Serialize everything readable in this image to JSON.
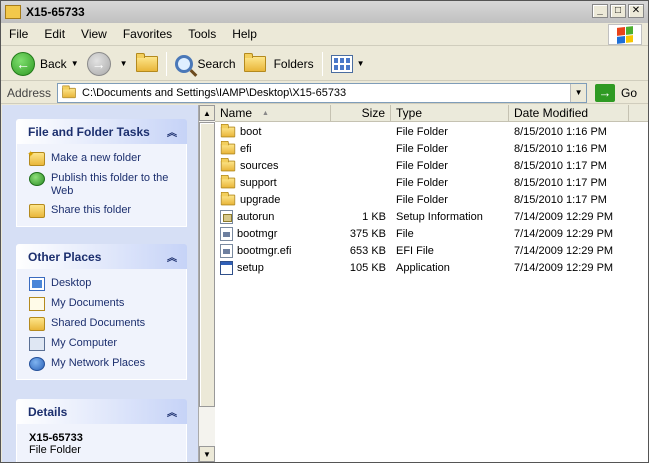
{
  "window": {
    "title": "X15-65733"
  },
  "menu": [
    "File",
    "Edit",
    "View",
    "Favorites",
    "Tools",
    "Help"
  ],
  "toolbar": {
    "back_label": "Back",
    "search_label": "Search",
    "folders_label": "Folders"
  },
  "address": {
    "label": "Address",
    "path": "C:\\Documents and Settings\\IAMP\\Desktop\\X15-65733",
    "go_label": "Go"
  },
  "tasks": {
    "title": "File and Folder Tasks",
    "items": [
      "Make a new folder",
      "Publish this folder to the Web",
      "Share this folder"
    ]
  },
  "places": {
    "title": "Other Places",
    "items": [
      "Desktop",
      "My Documents",
      "Shared Documents",
      "My Computer",
      "My Network Places"
    ]
  },
  "details": {
    "title": "Details",
    "name": "X15-65733",
    "type": "File Folder"
  },
  "columns": {
    "name": "Name",
    "size": "Size",
    "type": "Type",
    "date": "Date Modified"
  },
  "files": [
    {
      "name": "boot",
      "size": "",
      "type": "File Folder",
      "date": "8/15/2010 1:16 PM",
      "icon": "folder"
    },
    {
      "name": "efi",
      "size": "",
      "type": "File Folder",
      "date": "8/15/2010 1:16 PM",
      "icon": "folder"
    },
    {
      "name": "sources",
      "size": "",
      "type": "File Folder",
      "date": "8/15/2010 1:17 PM",
      "icon": "folder"
    },
    {
      "name": "support",
      "size": "",
      "type": "File Folder",
      "date": "8/15/2010 1:17 PM",
      "icon": "folder"
    },
    {
      "name": "upgrade",
      "size": "",
      "type": "File Folder",
      "date": "8/15/2010 1:17 PM",
      "icon": "folder"
    },
    {
      "name": "autorun",
      "size": "1 KB",
      "type": "Setup Information",
      "date": "7/14/2009 12:29 PM",
      "icon": "inf"
    },
    {
      "name": "bootmgr",
      "size": "375 KB",
      "type": "File",
      "date": "7/14/2009 12:29 PM",
      "icon": "sys"
    },
    {
      "name": "bootmgr.efi",
      "size": "653 KB",
      "type": "EFI File",
      "date": "7/14/2009 12:29 PM",
      "icon": "sys"
    },
    {
      "name": "setup",
      "size": "105 KB",
      "type": "Application",
      "date": "7/14/2009 12:29 PM",
      "icon": "app"
    }
  ]
}
